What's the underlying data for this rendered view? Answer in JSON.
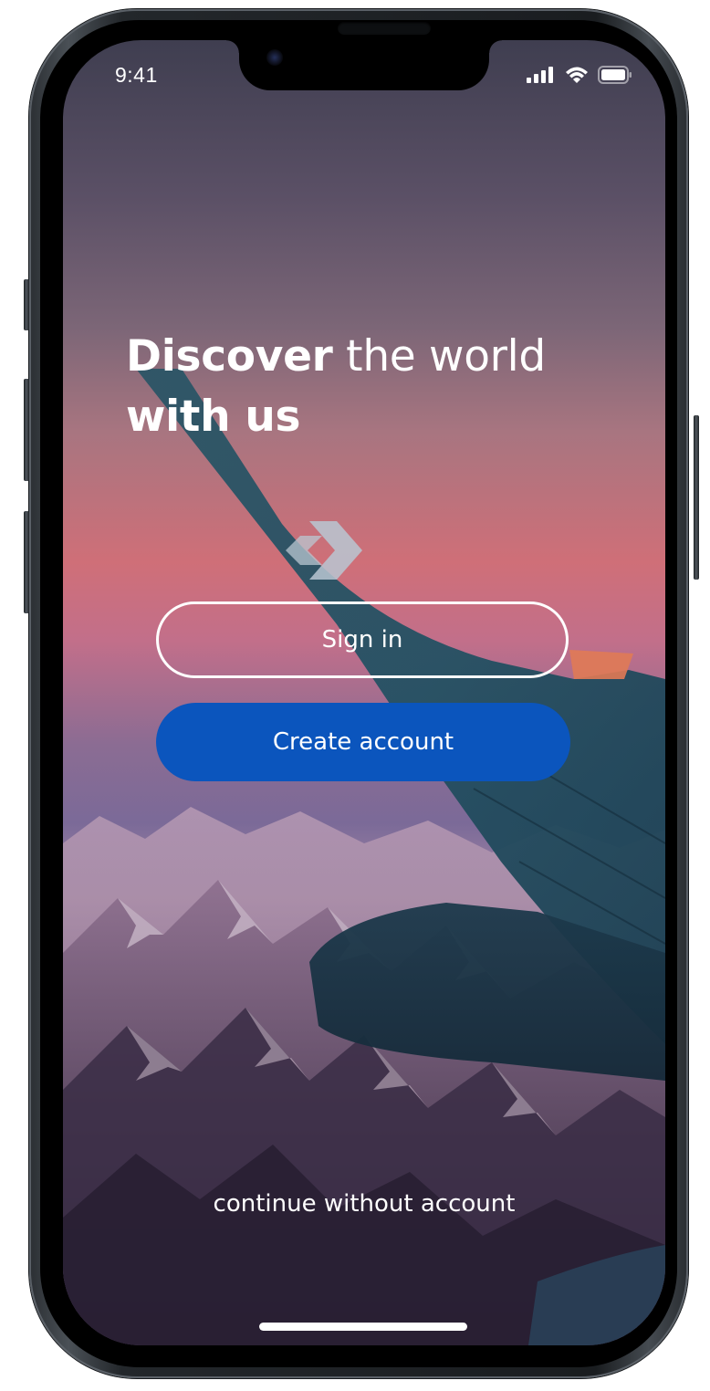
{
  "status_bar": {
    "time": "9:41",
    "signal_icon": "cellular-signal-icon",
    "wifi_icon": "wifi-icon",
    "battery_icon": "battery-icon"
  },
  "hero": {
    "headline_bold_1": "Discover",
    "headline_regular": " the world",
    "headline_bold_2": "with us",
    "tail_logo_icon": "airline-logo-icon"
  },
  "actions": {
    "sign_in_label": "Sign in",
    "create_account_label": "Create account",
    "continue_label": "continue without account"
  },
  "colors": {
    "primary_button": "#0b55bd",
    "text": "#ffffff"
  }
}
